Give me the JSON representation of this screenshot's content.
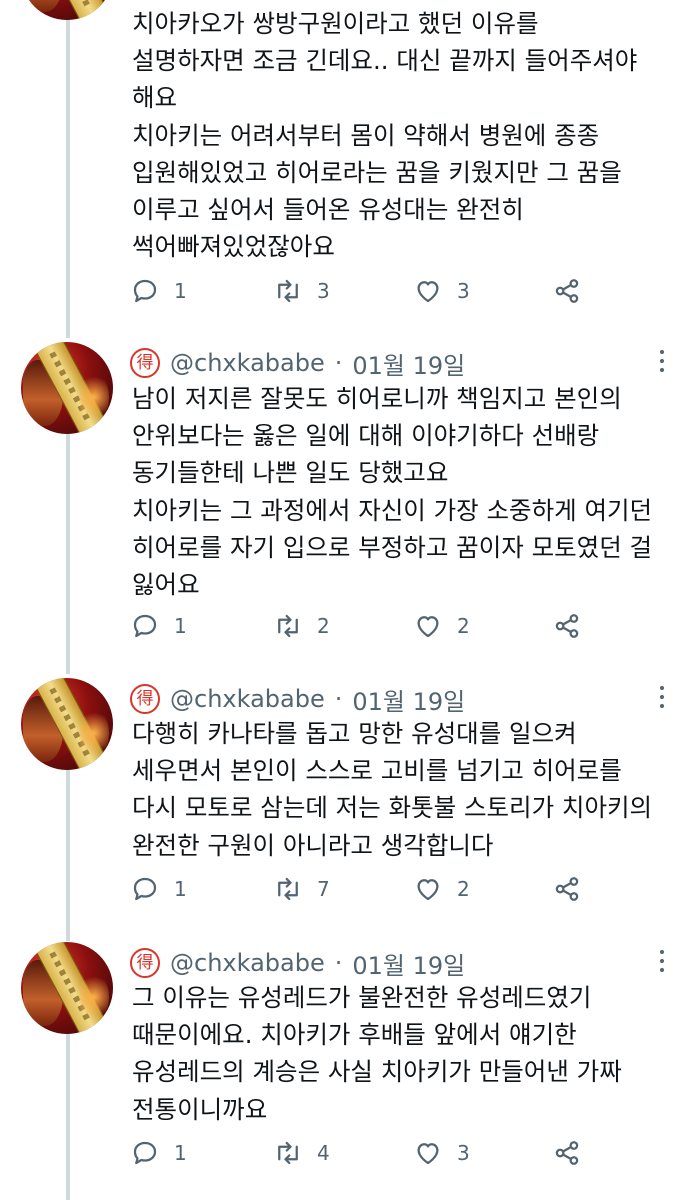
{
  "first_tweet": {
    "lines": [
      "치아카오가 쌍방구원이라고 했던 이유를",
      "설명하자면 조금 긴데요.. 대신 끝까지 들어주셔야",
      "해요",
      "치아키는 어려서부터 몸이 약해서 병원에 종종",
      "입원해있었고 히어로라는 꿈을 키웠지만 그 꿈을",
      "이루고 싶어서 들어온 유성대는 완전히",
      "썩어빠져있었잖아요"
    ],
    "replies": "1",
    "retweets": "3",
    "likes": "3"
  },
  "tweets": [
    {
      "badge": "得",
      "handle": "@chxkababe",
      "separator": "·",
      "date": "01월 19일",
      "lines": [
        "남이 저지른 잘못도 히어로니까 책임지고 본인의",
        "안위보다는 옳은 일에 대해 이야기하다 선배랑",
        "동기들한테 나쁜 일도 당했고요",
        "치아키는 그 과정에서 자신이 가장 소중하게 여기던",
        "히어로를 자기 입으로 부정하고 꿈이자 모토였던 걸",
        "잃어요"
      ],
      "replies": "1",
      "retweets": "2",
      "likes": "2"
    },
    {
      "badge": "得",
      "handle": "@chxkababe",
      "separator": "·",
      "date": "01월 19일",
      "lines": [
        "다행히 카나타를 돕고 망한 유성대를 일으켜",
        "세우면서 본인이 스스로 고비를 넘기고 히어로를",
        "다시 모토로 삼는데 저는 화톳불 스토리가 치아키의",
        "완전한 구원이 아니라고 생각합니다"
      ],
      "replies": "1",
      "retweets": "7",
      "likes": "2"
    },
    {
      "badge": "得",
      "handle": "@chxkababe",
      "separator": "·",
      "date": "01월 19일",
      "lines": [
        "그 이유는 유성레드가 불완전한 유성레드였기",
        "때문이에요. 치아키가 후배들 앞에서 얘기한",
        "유성레드의 계승은 사실 치아키가 만들어낸 가짜",
        "전통이니까요"
      ],
      "replies": "1",
      "retweets": "4",
      "likes": "3"
    }
  ],
  "icons": {
    "reply": "reply-bubble-icon",
    "retweet": "retweet-arrows-icon",
    "like": "heart-outline-icon",
    "share": "share-nodes-icon",
    "more": "more-dots-icon",
    "badge": "red-seal-badge-icon"
  },
  "colors": {
    "text": "#0f1419",
    "muted": "#536471",
    "thread_line": "#cfd9de",
    "badge_red": "#d9362b"
  }
}
